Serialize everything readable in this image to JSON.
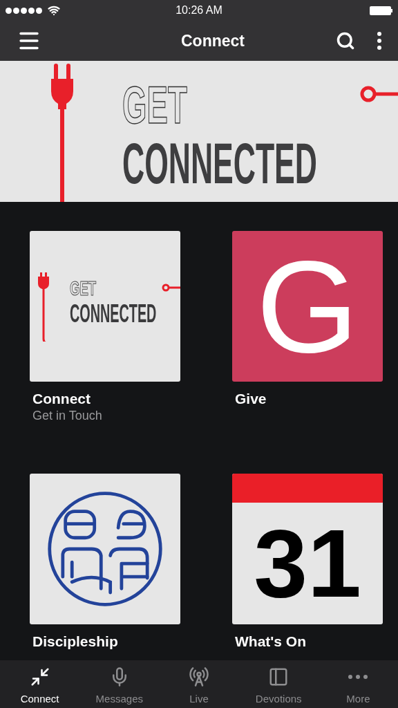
{
  "status_bar": {
    "time": "10:26 AM"
  },
  "nav": {
    "title": "Connect"
  },
  "banner": {
    "line_1": "GET",
    "line_2": "CONNECTED"
  },
  "tiles": [
    {
      "kind": "connect-art",
      "title": "Connect",
      "subtitle": "Get in Touch",
      "art_line_1": "GET",
      "art_line_2": "CONNECTED"
    },
    {
      "kind": "letter",
      "title": "Give",
      "letter": "G"
    },
    {
      "kind": "people",
      "title": "Discipleship"
    },
    {
      "kind": "calendar",
      "title": "What's On",
      "day": "31"
    }
  ],
  "tab_bar": [
    {
      "kind": "connect",
      "label": "Connect",
      "selected": true
    },
    {
      "kind": "mic",
      "label": "Messages",
      "selected": false
    },
    {
      "kind": "tower",
      "label": "Live",
      "selected": false
    },
    {
      "kind": "book",
      "label": "Devotions",
      "selected": false
    },
    {
      "kind": "more",
      "label": "More",
      "selected": false
    }
  ]
}
